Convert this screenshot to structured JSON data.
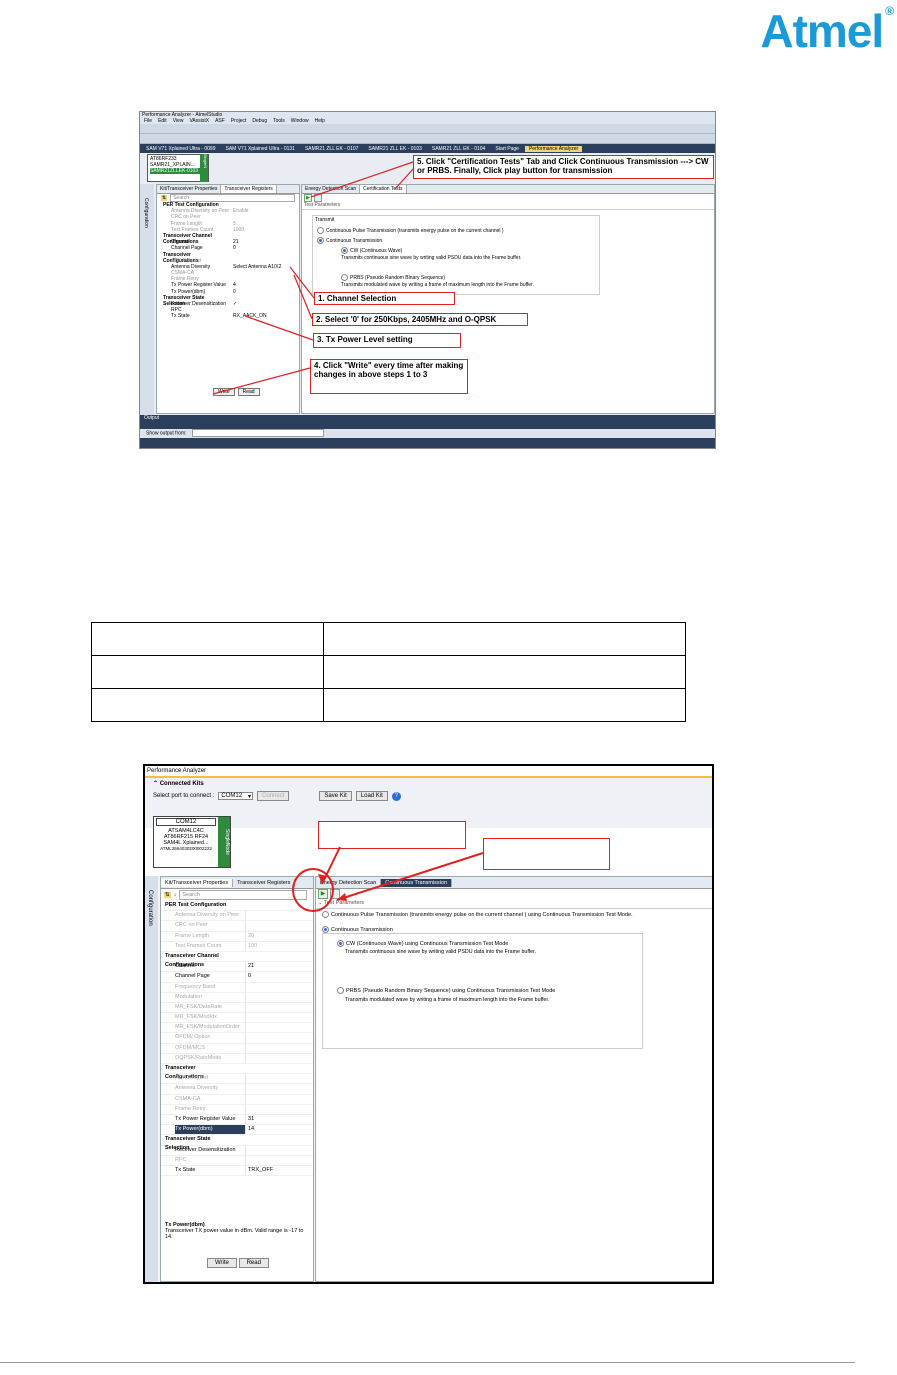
{
  "logo": {
    "text": "Atmel",
    "reg": "®"
  },
  "shot1": {
    "title": "Performance Analyzer - AtmelStudio",
    "menu": [
      "File",
      "Edit",
      "View",
      "VAssistX",
      "ASF",
      "Project",
      "Debug",
      "Tools",
      "Window",
      "Help"
    ],
    "doctabs": [
      "SAM V71 Xplained Ultra - 0099",
      "SAM V71 Xplained Ultra - 0131",
      "SAMR21 ZLL EK - 0107",
      "SAMR21 ZLL EK - 0103",
      "SAMR21 ZLL EK - 0104",
      "Start Page",
      "Performance Analyzer"
    ],
    "kit": {
      "l1": "AT86RF233",
      "l2": "SAMR21_XPLAIN...",
      "l3": "SAMR21ZLLEK-0103",
      "badge": "SingleN"
    },
    "side_label": "Configuration",
    "left_tabs": [
      "Kit/Transceiver Properties",
      "Transceiver Registers"
    ],
    "search_placeholder": "Search",
    "rows": [
      {
        "k": "PER Test Configuration",
        "v": "",
        "type": "sec"
      },
      {
        "k": "Antenna Diversity on Peer",
        "v": "Enable",
        "type": "dim"
      },
      {
        "k": "CRC on Peer",
        "v": "",
        "type": "dim"
      },
      {
        "k": "Frame Length",
        "v": "5",
        "type": "dim"
      },
      {
        "k": "Test Frames Count",
        "v": "1000",
        "type": "dim"
      },
      {
        "k": "Transceiver Channel Configurations",
        "v": "",
        "type": "sec"
      },
      {
        "k": "Channel",
        "v": "21",
        "type": ""
      },
      {
        "k": "Channel Page",
        "v": "0",
        "type": ""
      },
      {
        "k": "Transceiver Configurations",
        "v": "",
        "type": "sec"
      },
      {
        "k": "ACK Request",
        "v": "",
        "type": "dim"
      },
      {
        "k": "Antenna Diversity",
        "v": "Select Antenna A1/X2",
        "type": ""
      },
      {
        "k": "CSMA-CA",
        "v": "",
        "type": "dim"
      },
      {
        "k": "Frame Retry",
        "v": "",
        "type": "dim"
      },
      {
        "k": "Tx Power Register Value",
        "v": "4",
        "type": ""
      },
      {
        "k": "Tx Power(dbm)",
        "v": "0",
        "type": ""
      },
      {
        "k": "Transceiver State Selection",
        "v": "",
        "type": "sec"
      },
      {
        "k": "Receiver Desensitization",
        "v": "✓",
        "type": ""
      },
      {
        "k": "RPC",
        "v": "",
        "type": ""
      },
      {
        "k": "Tx State",
        "v": "RX_AACK_ON",
        "type": ""
      }
    ],
    "write": "Write",
    "read": "Read",
    "right_tabs": [
      "Energy Detection Scan",
      "Certification Tests"
    ],
    "test_parameters": "Test Parameters",
    "transmit": "Transmit",
    "opt_cpt": "Continuous Pulse Transmission (transmits energy pulse on the current channel )",
    "opt_ct": "Continuous Transmission",
    "opt_cw": "CW (Continuous Wave)",
    "opt_cw_desc": "Transmits continuous sine wave by writing valid PSDU data into the Frame buffer.",
    "opt_prbs": "PRBS (Pseudo Random Binary Sequence)",
    "opt_prbs_desc": "Transmits modulated wave by writing a frame of maximum length into the Frame buffer.",
    "output_title": "Output",
    "output_label": "Show output from:",
    "callout1": "1. Channel Selection",
    "callout2": "2. Select '0' for 250Kbps, 2405MHz and O-QPSK",
    "callout3": "3. Tx Power Level setting",
    "callout4": "4. Click \"Write\" every time after making changes in above steps 1 to 3",
    "callout5": "5. Click \"Certification Tests\" Tab and Click Continuous Transmission ---> CW or PRBS. Finally, Click play button for transmission"
  },
  "shot2": {
    "title": "Performance Analyzer",
    "connected": "Connected Kits",
    "select_port": "Select port to connect :",
    "port": "COM12",
    "connect": "Connect",
    "save_kit": "Save Kit",
    "load_kit": "Load Kit",
    "kit": {
      "port": "COM12",
      "l1": "ATSAM4LC4C",
      "l2": "AT86RF215 RF24",
      "l3": "SAM4L Xplained...",
      "l4": "ATML2664030200002222",
      "badge": "SingleNode"
    },
    "side_label": "Configuration",
    "left_tabs": [
      "Kit/Transceiver Properties",
      "Transceiver Registers"
    ],
    "search_placeholder": "Search",
    "rows": [
      {
        "k": "PER Test Configuration",
        "v": "",
        "type": "sec"
      },
      {
        "k": "Antenna Diversity on Peer",
        "v": "",
        "type": "dim"
      },
      {
        "k": "CRC on Peer",
        "v": "",
        "type": "dim"
      },
      {
        "k": "Frame Length",
        "v": "20",
        "type": "dim"
      },
      {
        "k": "Test Frames Count",
        "v": "100",
        "type": "dim"
      },
      {
        "k": "Transceiver Channel Configurations",
        "v": "",
        "type": "sec"
      },
      {
        "k": "Channel",
        "v": "21",
        "type": ""
      },
      {
        "k": "Channel Page",
        "v": "0",
        "type": ""
      },
      {
        "k": "Frequency Band",
        "v": "",
        "type": "dim"
      },
      {
        "k": "Modulation",
        "v": "",
        "type": "dim"
      },
      {
        "k": "MR_FSK/DataRate",
        "v": "",
        "type": "dim"
      },
      {
        "k": "MR_FSK/ModIdx",
        "v": "",
        "type": "dim"
      },
      {
        "k": "MR_FSK/ModulationOrder",
        "v": "",
        "type": "dim"
      },
      {
        "k": "OFDM/ Option",
        "v": "",
        "type": "dim"
      },
      {
        "k": "OFDM/MCS",
        "v": "",
        "type": "dim"
      },
      {
        "k": "OQPSK/RateMode",
        "v": "",
        "type": "dim"
      },
      {
        "k": "Transceiver Configurations",
        "v": "",
        "type": "sec"
      },
      {
        "k": "ACK Request",
        "v": "",
        "type": "dim"
      },
      {
        "k": "Antenna Diversity",
        "v": "",
        "type": "dim"
      },
      {
        "k": "CSMA-CA",
        "v": "",
        "type": "dim"
      },
      {
        "k": "Frame Retry",
        "v": "",
        "type": "dim"
      },
      {
        "k": "Tx Power Register Value",
        "v": "31",
        "type": ""
      },
      {
        "k": "Tx Power(dbm)",
        "v": "14",
        "type": "sel"
      },
      {
        "k": "Transceiver State Selection",
        "v": "",
        "type": "sec"
      },
      {
        "k": "Receiver Desensitization",
        "v": "",
        "type": ""
      },
      {
        "k": "RPC",
        "v": "",
        "type": "dim"
      },
      {
        "k": "Tx State",
        "v": "TRX_OFF",
        "type": ""
      }
    ],
    "desc_title": "Tx Power(dbm)",
    "desc_text": "Transceiver TX power value in dBm. Valid range is -17 to 14.",
    "write": "Write",
    "read": "Read",
    "right_tabs": [
      "Energy Detection Scan",
      "Continuous Transmission"
    ],
    "test_parameters": "Test Parameters",
    "opt_cpt": "Continuous Pulse Transmission (transmits energy pulse on the current channel ) using Continuous Transmission Test Mode.",
    "opt_ct": "Continuous Transmission",
    "opt_cw": "CW (Continuous Wave) using Continuous Transmission Test Mode",
    "opt_cw_desc": "Transmits continuous sine wave by writing valid PSDU data into the Frame buffer.",
    "opt_prbs": "PRBS (Pseudo Random Binary Sequence) using Continuous Transmission Test Mode",
    "opt_prbs_desc": "Transmits modulated wave by writing a frame of maximum length into the Frame buffer."
  }
}
